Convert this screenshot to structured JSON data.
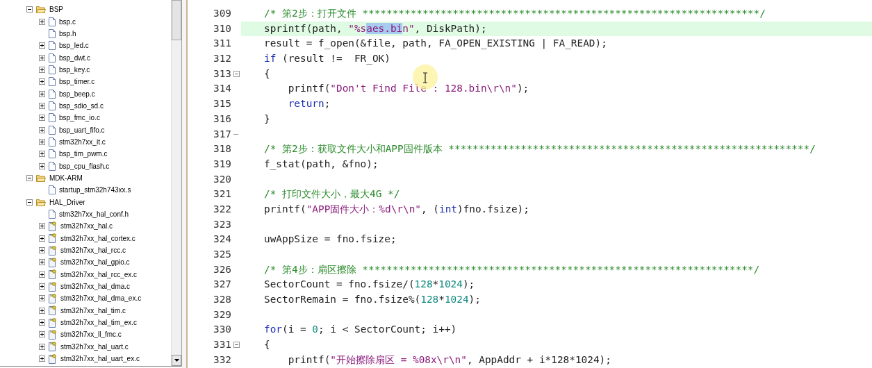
{
  "project_tree": {
    "items": [
      {
        "label": "BSP",
        "kind": "folder",
        "expanded": true,
        "children": [
          {
            "label": "bsp.c",
            "kind": "file",
            "expandable": true
          },
          {
            "label": "bsp.h",
            "kind": "file",
            "expandable": false
          },
          {
            "label": "bsp_led.c",
            "kind": "file",
            "expandable": true
          },
          {
            "label": "bsp_dwt.c",
            "kind": "file",
            "expandable": true
          },
          {
            "label": "bsp_key.c",
            "kind": "file",
            "expandable": true
          },
          {
            "label": "bsp_timer.c",
            "kind": "file",
            "expandable": true
          },
          {
            "label": "bsp_beep.c",
            "kind": "file",
            "expandable": true
          },
          {
            "label": "bsp_sdio_sd.c",
            "kind": "file",
            "expandable": true
          },
          {
            "label": "bsp_fmc_io.c",
            "kind": "file",
            "expandable": true
          },
          {
            "label": "bsp_uart_fifo.c",
            "kind": "file",
            "expandable": true
          },
          {
            "label": "stm32h7xx_it.c",
            "kind": "file",
            "expandable": true
          },
          {
            "label": "bsp_tim_pwm.c",
            "kind": "file",
            "expandable": true
          },
          {
            "label": "bsp_cpu_flash.c",
            "kind": "file",
            "expandable": true
          }
        ]
      },
      {
        "label": "MDK-ARM",
        "kind": "folder",
        "expanded": true,
        "children": [
          {
            "label": "startup_stm32h743xx.s",
            "kind": "file",
            "expandable": false
          }
        ]
      },
      {
        "label": "HAL_Driver",
        "kind": "folder",
        "expanded": true,
        "children": [
          {
            "label": "stm32h7xx_hal_conf.h",
            "kind": "file",
            "expandable": false
          },
          {
            "label": "stm32h7xx_hal.c",
            "kind": "key-file",
            "expandable": true
          },
          {
            "label": "stm32h7xx_hal_cortex.c",
            "kind": "key-file",
            "expandable": true
          },
          {
            "label": "stm32h7xx_hal_rcc.c",
            "kind": "key-file",
            "expandable": true
          },
          {
            "label": "stm32h7xx_hal_gpio.c",
            "kind": "key-file",
            "expandable": true
          },
          {
            "label": "stm32h7xx_hal_rcc_ex.c",
            "kind": "key-file",
            "expandable": true
          },
          {
            "label": "stm32h7xx_hal_dma.c",
            "kind": "key-file",
            "expandable": true
          },
          {
            "label": "stm32h7xx_hal_dma_ex.c",
            "kind": "key-file",
            "expandable": true
          },
          {
            "label": "stm32h7xx_hal_tim.c",
            "kind": "key-file",
            "expandable": true
          },
          {
            "label": "stm32h7xx_hal_tim_ex.c",
            "kind": "key-file",
            "expandable": true
          },
          {
            "label": "stm32h7xx_ll_fmc.c",
            "kind": "key-file",
            "expandable": true
          },
          {
            "label": "stm32h7xx_hal_uart.c",
            "kind": "key-file",
            "expandable": true
          },
          {
            "label": "stm32h7xx_hal_uart_ex.c",
            "kind": "key-file",
            "expandable": true
          }
        ]
      }
    ]
  },
  "editor": {
    "lines": [
      {
        "number": "309",
        "highlighted": false,
        "segments": [
          {
            "text": "/* 第2步：打开文件 ******************************************************************/",
            "kind": "comment"
          }
        ]
      },
      {
        "number": "310",
        "highlighted": true,
        "segments": [
          {
            "text": "sprintf(path, ",
            "kind": "plain"
          },
          {
            "text": "\"%s",
            "kind": "string"
          },
          {
            "text": "aes.bi",
            "kind": "selected"
          },
          {
            "text": "n\"",
            "kind": "string"
          },
          {
            "text": ", DiskPath);",
            "kind": "plain"
          }
        ]
      },
      {
        "number": "311",
        "highlighted": false,
        "segments": [
          {
            "text": "result = f_open(&file, path, FA_OPEN_EXISTING | FA_READ);",
            "kind": "plain"
          }
        ]
      },
      {
        "number": "312",
        "highlighted": false,
        "segments": [
          {
            "text": "if",
            "kind": "keyword"
          },
          {
            "text": " (result !=  FR_OK)",
            "kind": "plain"
          }
        ]
      },
      {
        "number": "313",
        "highlighted": false,
        "kind": "fold-start",
        "segments": [
          {
            "text": "{",
            "kind": "plain"
          }
        ]
      },
      {
        "number": "314",
        "highlighted": false,
        "segments": [
          {
            "text": "    printf(",
            "kind": "plain"
          },
          {
            "text": "\"Don't Find File : 128.bin\\r\\n\"",
            "kind": "string"
          },
          {
            "text": ");",
            "kind": "plain"
          }
        ]
      },
      {
        "number": "315",
        "highlighted": false,
        "segments": [
          {
            "text": "    return",
            "kind": "keyword"
          },
          {
            "text": ";",
            "kind": "plain"
          }
        ]
      },
      {
        "number": "316",
        "highlighted": false,
        "segments": [
          {
            "text": "}",
            "kind": "plain"
          }
        ]
      },
      {
        "number": "317",
        "highlighted": false,
        "kind": "fold-end"
      },
      {
        "number": "318",
        "highlighted": false,
        "segments": [
          {
            "text": "/* 第2步：获取文件大小和APP固件版本 ************************************************************/",
            "kind": "comment"
          }
        ]
      },
      {
        "number": "319",
        "highlighted": false,
        "segments": [
          {
            "text": "f_stat(path, &fno);",
            "kind": "plain"
          }
        ]
      },
      {
        "number": "320",
        "highlighted": false
      },
      {
        "number": "321",
        "highlighted": false,
        "segments": [
          {
            "text": "/* 打印文件大小，最大4G */",
            "kind": "comment"
          }
        ]
      },
      {
        "number": "322",
        "highlighted": false,
        "segments": [
          {
            "text": "printf(",
            "kind": "plain"
          },
          {
            "text": "\"APP固件大小：%d\\r\\n\"",
            "kind": "string"
          },
          {
            "text": ", (",
            "kind": "plain"
          },
          {
            "text": "int",
            "kind": "keyword"
          },
          {
            "text": ")fno.fsize);",
            "kind": "plain"
          }
        ]
      },
      {
        "number": "323",
        "highlighted": false
      },
      {
        "number": "324",
        "highlighted": false,
        "segments": [
          {
            "text": "uwAppSize = fno.fsize;",
            "kind": "plain"
          }
        ]
      },
      {
        "number": "325",
        "highlighted": false
      },
      {
        "number": "326",
        "highlighted": false,
        "segments": [
          {
            "text": "/* 第4步：扇区擦除 *****************************************************************/",
            "kind": "comment"
          }
        ]
      },
      {
        "number": "327",
        "highlighted": false,
        "segments": [
          {
            "text": "SectorCount = fno.fsize/(",
            "kind": "plain"
          },
          {
            "text": "128",
            "kind": "number"
          },
          {
            "text": "*",
            "kind": "plain"
          },
          {
            "text": "1024",
            "kind": "number"
          },
          {
            "text": ");",
            "kind": "plain"
          }
        ]
      },
      {
        "number": "328",
        "highlighted": false,
        "segments": [
          {
            "text": "SectorRemain = fno.fsize%(",
            "kind": "plain"
          },
          {
            "text": "128",
            "kind": "number"
          },
          {
            "text": "*",
            "kind": "plain"
          },
          {
            "text": "1024",
            "kind": "number"
          },
          {
            "text": ");",
            "kind": "plain"
          }
        ]
      },
      {
        "number": "329",
        "highlighted": false
      },
      {
        "number": "330",
        "highlighted": false,
        "segments": [
          {
            "text": "for",
            "kind": "keyword"
          },
          {
            "text": "(i = ",
            "kind": "plain"
          },
          {
            "text": "0",
            "kind": "number"
          },
          {
            "text": "; i < SectorCount; i++)",
            "kind": "plain"
          }
        ]
      },
      {
        "number": "331",
        "highlighted": false,
        "kind": "fold-start",
        "segments": [
          {
            "text": "{",
            "kind": "plain"
          }
        ]
      },
      {
        "number": "332",
        "highlighted": false,
        "segments": [
          {
            "text": "    printf(",
            "kind": "plain"
          },
          {
            "text": "\"开始擦除扇区 = %08x\\r\\n\"",
            "kind": "string"
          },
          {
            "text": ", AppAddr + i*128*1024);",
            "kind": "plain"
          }
        ]
      }
    ]
  }
}
